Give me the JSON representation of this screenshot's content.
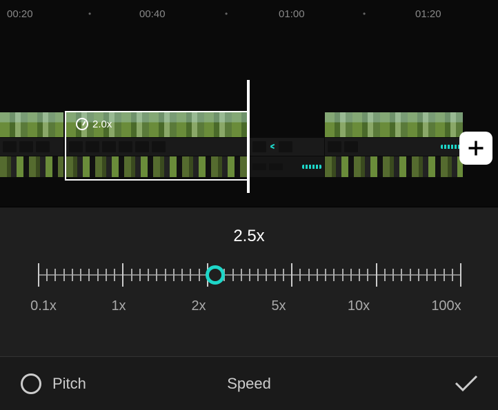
{
  "ruler": {
    "marks": [
      "00:20",
      "00:40",
      "01:00",
      "01:20"
    ]
  },
  "clip": {
    "speed_badge": "2.0x"
  },
  "speed": {
    "current": "2.5x",
    "labels": [
      "0.1x",
      "1x",
      "2x",
      "5x",
      "10x",
      "100x"
    ]
  },
  "bottom": {
    "pitch": "Pitch",
    "title": "Speed"
  }
}
